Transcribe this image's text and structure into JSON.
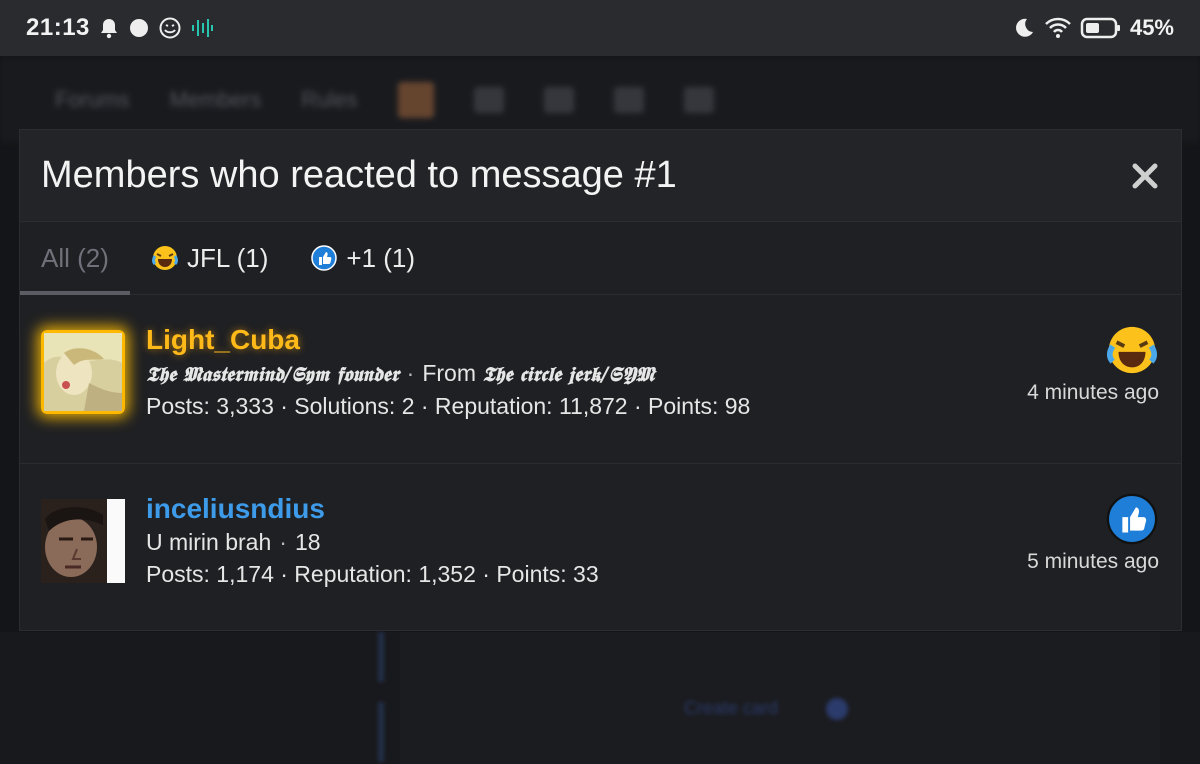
{
  "status_bar": {
    "time": "21:13",
    "battery": "45%",
    "icons": [
      "bell-icon",
      "circle-icon",
      "smiley-icon",
      "sound-wave-icon",
      "moon-icon",
      "wifi-icon",
      "battery-icon"
    ]
  },
  "modal": {
    "title": "Members who reacted to message #1",
    "close_icon": "close-icon"
  },
  "tabs": [
    {
      "label": "All (2)",
      "active": true
    },
    {
      "label": "JFL (1)",
      "icon": "laugh-cry-icon"
    },
    {
      "label": "+1 (1)",
      "icon": "thumbs-up-icon"
    }
  ],
  "members": [
    {
      "name": "Light_Cuba",
      "title": "𝕿𝖍𝖊 𝕸𝖆𝖘𝖙𝖊𝖗𝖒𝖎𝖓𝖉/𝕾𝖞𝖒 𝖋𝖔𝖚𝖓𝖉𝖊𝖗",
      "from_label": "From",
      "location": "𝕿𝖍𝖊 𝖈𝖎𝖗𝖈𝖑𝖊 𝖏𝖊𝖗𝖐/𝕾𝖄𝕸",
      "stats": "Posts: 3,333 · Solutions: 2 · Reputation: 11,872 · Points: 98",
      "reaction_icon": "laugh-cry-icon",
      "time": "4 minutes ago",
      "name_color": "#ffba1a"
    },
    {
      "name": "inceliusndius",
      "title": "U mirin brah",
      "age": "18",
      "stats": "Posts: 1,174 · Reputation: 1,352 · Points: 33",
      "reaction_icon": "thumbs-up-icon",
      "time": "5 minutes ago",
      "name_color": "#3d9be9"
    }
  ],
  "background": {
    "nav_items": [
      "Forums",
      "Members",
      "Rules"
    ],
    "bottom_button": "Create card"
  }
}
